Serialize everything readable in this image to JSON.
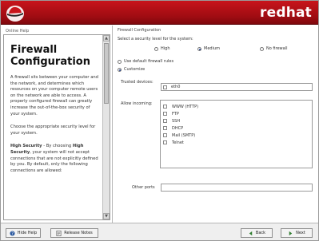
{
  "header": {
    "brand": "redhat"
  },
  "help": {
    "pane_label": "Online Help",
    "title": "Firewall Configuration",
    "para1": "A firewall sits between your computer and the network, and determines which resources on your computer remote users on the network are able to access. A properly configured firewall can greatly increase the out-of-the-box security of your system.",
    "para2": "Choose the appropriate security level for your system.",
    "para3_bold1": "High Security",
    "para3_mid": " - By choosing ",
    "para3_bold2": "High Security",
    "para3_rest": ", your system will not accept connections that are not explicitly defined by you. By default, only the following connections are allowed:"
  },
  "firewall": {
    "section_title": "Firewall Configuration",
    "security_prompt": "Select a security level for the system:",
    "levels": [
      "High",
      "Medium",
      "No firewall"
    ],
    "selected_level": "Medium",
    "rules_options": [
      "Use default firewall rules",
      "Customize"
    ],
    "selected_rules": "Customize",
    "trusted_label": "Trusted devices:",
    "trusted_device": "eth0",
    "allow_label": "Allow incoming:",
    "services": [
      "WWW (HTTP)",
      "FTP",
      "SSH",
      "DHCP",
      "Mail (SMTP)",
      "Telnet"
    ],
    "other_ports_label": "Other ports",
    "other_ports_value": ""
  },
  "buttons": {
    "hide_help": "Hide Help",
    "release_notes": "Release Notes",
    "back": "Back",
    "next": "Next"
  },
  "colors": {
    "banner": "#b0101a",
    "accent": "#1a3a8c"
  },
  "icons": [
    "redhat-logo-icon",
    "help-icon",
    "notes-icon",
    "back-arrow-icon",
    "next-arrow-icon"
  ]
}
